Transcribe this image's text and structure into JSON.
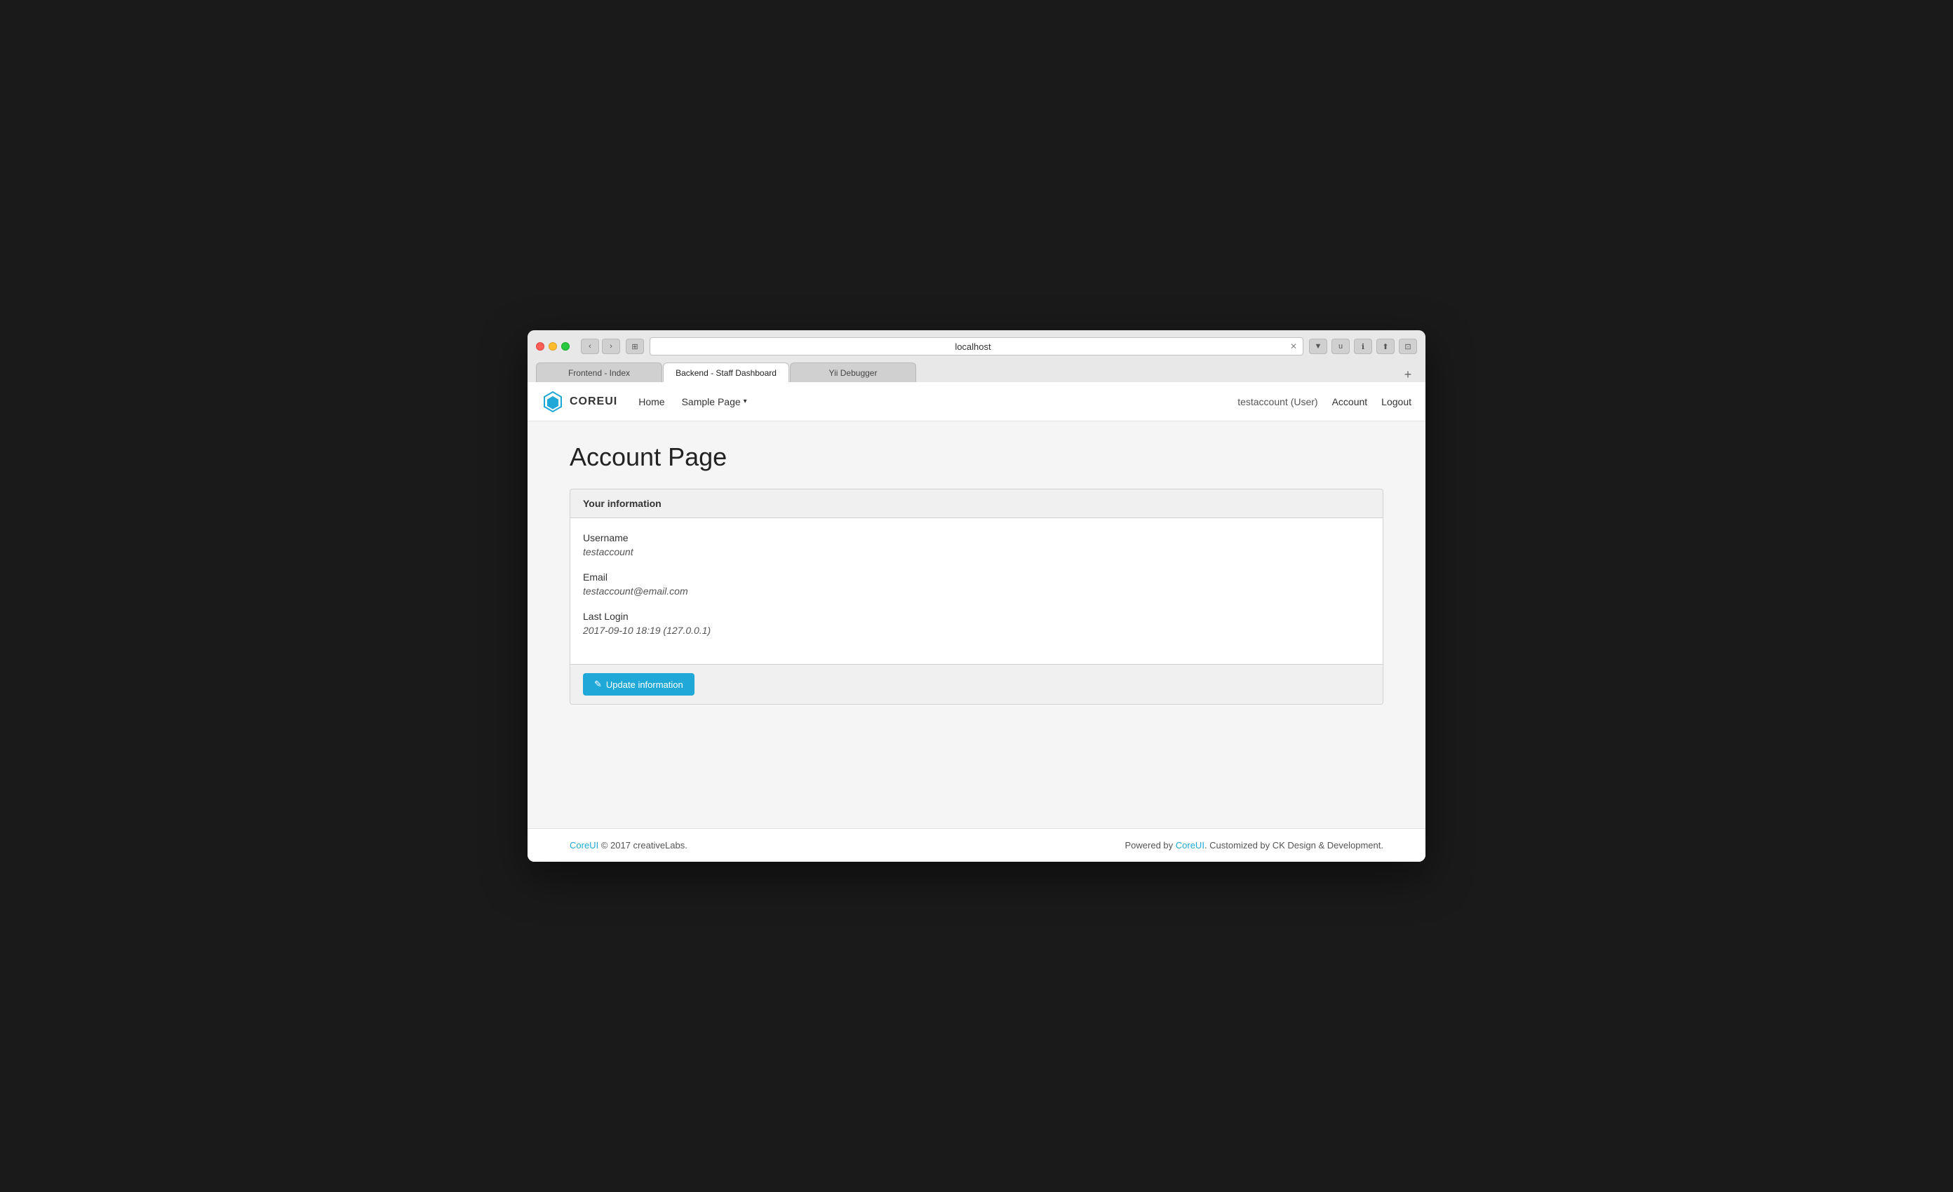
{
  "browser": {
    "address": "localhost",
    "tabs": [
      {
        "label": "Frontend - Index",
        "active": false
      },
      {
        "label": "Backend - Staff Dashboard",
        "active": true
      },
      {
        "label": "Yii Debugger",
        "active": false
      }
    ],
    "add_tab_label": "+"
  },
  "navbar": {
    "logo_text": "COREUI",
    "links": [
      {
        "label": "Home"
      },
      {
        "label": "Sample Page",
        "has_dropdown": true
      }
    ],
    "user_label": "testaccount (User)",
    "account_label": "Account",
    "logout_label": "Logout"
  },
  "page": {
    "title": "Account Page",
    "card": {
      "header": "Your information",
      "fields": [
        {
          "label": "Username",
          "value": "testaccount"
        },
        {
          "label": "Email",
          "value": "testaccount@email.com"
        },
        {
          "label": "Last Login",
          "value": "2017-09-10 18:19 (127.0.0.1)"
        }
      ],
      "update_button": "Update information"
    }
  },
  "footer": {
    "left_link": "CoreUI",
    "left_text": "© 2017 creativeLabs.",
    "right_text_before": "Powered by ",
    "right_link": "CoreUI",
    "right_text_after": ". Customized by CK Design & Development."
  }
}
